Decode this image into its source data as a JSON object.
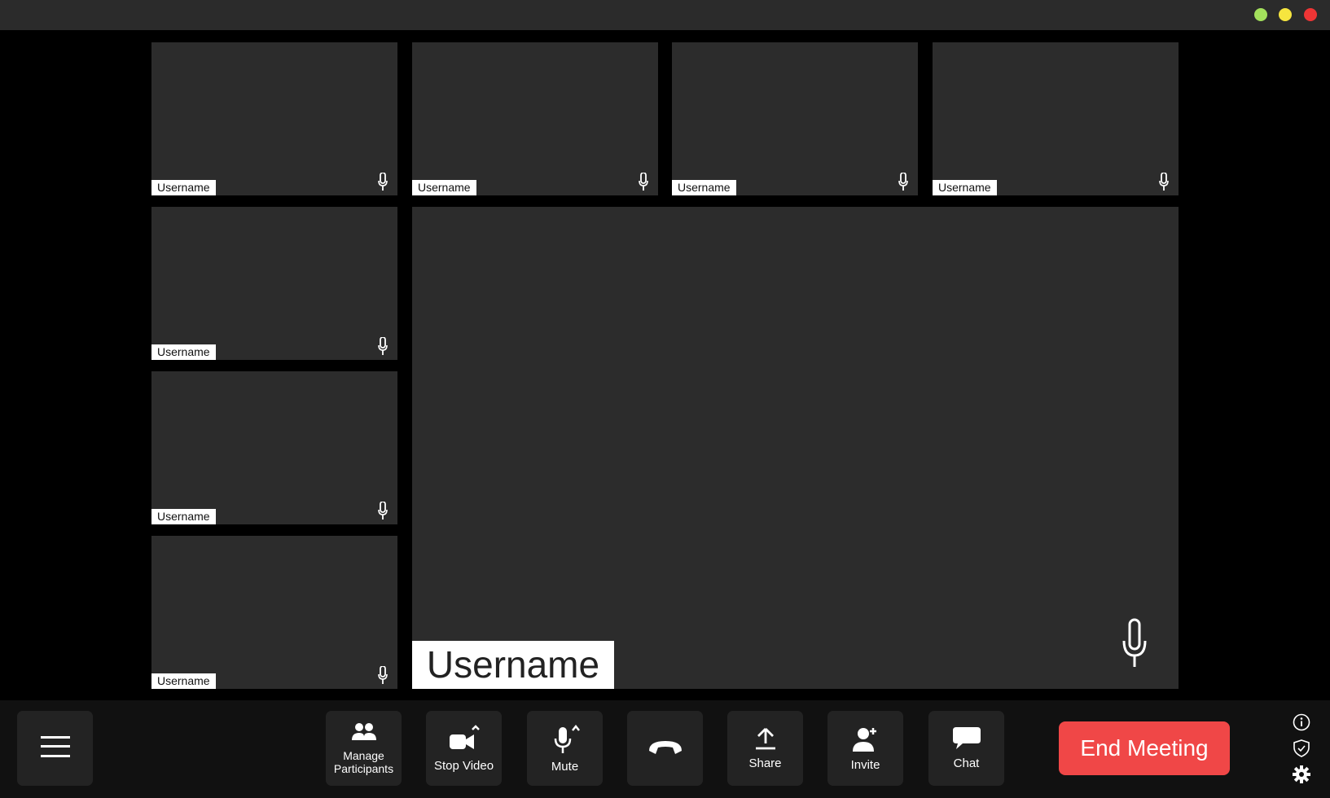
{
  "window": {
    "controls": [
      "green",
      "yellow",
      "red"
    ]
  },
  "participants": [
    {
      "name": "Username"
    },
    {
      "name": "Username"
    },
    {
      "name": "Username"
    },
    {
      "name": "Username"
    },
    {
      "name": "Username"
    },
    {
      "name": "Username"
    },
    {
      "name": "Username"
    }
  ],
  "active_speaker": {
    "name": "Username"
  },
  "toolbar": {
    "menu_icon": "hamburger-icon",
    "manage_participants_label": "Manage\nParticipants",
    "stop_video_label": "Stop Video",
    "mute_label": "Mute",
    "hangup_icon": "phone-hangup-icon",
    "share_label": "Share",
    "invite_label": "Invite",
    "chat_label": "Chat",
    "end_meeting_label": "End Meeting"
  },
  "side_icons": [
    "info-icon",
    "shield-icon",
    "gear-icon"
  ],
  "colors": {
    "end_meeting": "#f04747",
    "tile": "#2c2c2c",
    "toolbar_button": "#232323"
  }
}
